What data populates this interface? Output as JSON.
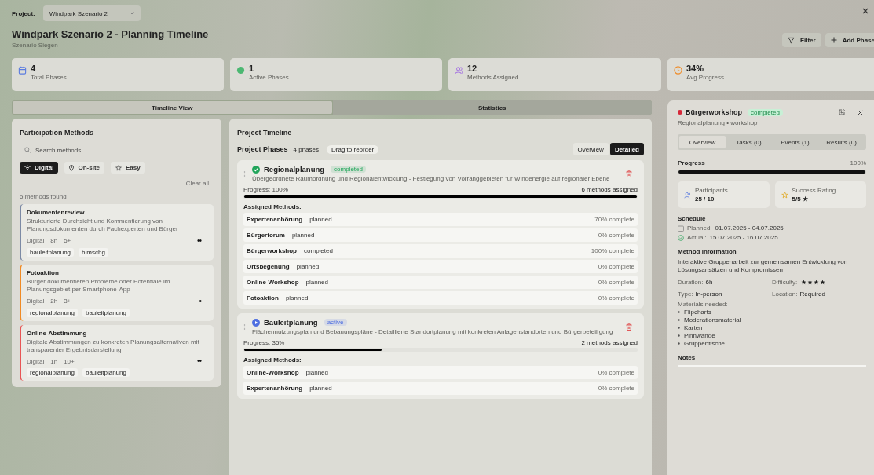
{
  "project": {
    "label": "Project:",
    "value": "Windpark Szenario 2"
  },
  "title": "Windpark Szenario 2 - Planning Timeline",
  "subtitle": "Szenario Siegen",
  "actions": [
    {
      "kind": "filter",
      "label": "Filter"
    },
    {
      "kind": "add",
      "label": "Add Phase"
    }
  ],
  "stats": [
    {
      "kind": "calendar",
      "value": "4",
      "label": "Total Phases"
    },
    {
      "kind": "dot",
      "value": "1",
      "label": "Active Phases"
    },
    {
      "kind": "people",
      "value": "12",
      "label": "Methods Assigned"
    },
    {
      "kind": "clock",
      "value": "34%",
      "label": "Avg Progress"
    }
  ],
  "view_tabs": [
    {
      "label": "Timeline View",
      "selected": true
    },
    {
      "label": "Statistics",
      "selected": false
    }
  ],
  "methods_panel": {
    "title": "Participation Methods",
    "search": {
      "placeholder": "Search methods..."
    },
    "chips": [
      {
        "kind": "wifi",
        "label": "Digital",
        "selected": true
      },
      {
        "kind": "pin",
        "label": "On-site",
        "selected": false
      },
      {
        "kind": "star",
        "label": "Easy",
        "selected": false
      }
    ],
    "clear": "Clear all",
    "count": "5 methods found",
    "methods": [
      {
        "name": "Dokumentenreview",
        "color": "#7c8aa5",
        "description": "Strukturierte Durchsicht und Kommentierung von Planungsdokumenten durch Fachexperten und Bürger",
        "mode": "Digital",
        "duration": "8h",
        "people": "5+",
        "dots": "••",
        "tags": [
          "bauleitplanung",
          "bimschg"
        ]
      },
      {
        "name": "Fotoaktion",
        "color": "#f08a24",
        "description": "Bürger dokumentieren Probleme oder Potentiale im Planungsgebiet per Smartphone-App",
        "mode": "Digital",
        "duration": "2h",
        "people": "3+",
        "dots": "•",
        "tags": [
          "regionalplanung",
          "bauleitplanung"
        ]
      },
      {
        "name": "Online-Abstimmung",
        "color": "#e85555",
        "description": "Digitale Abstimmungen zu konkreten Planungsalternativen mit transparenter Ergebnisdarstellung",
        "mode": "Digital",
        "duration": "1h",
        "people": "10+",
        "dots": "••",
        "tags": [
          "regionalplanung",
          "bauleitplanung"
        ]
      }
    ]
  },
  "timeline": {
    "title": "Project Timeline",
    "subtitle": "Project Phases",
    "phase_count": "4 phases",
    "drag_hint": "Drag to reorder",
    "modes": [
      {
        "label": "Overview",
        "selected": false
      },
      {
        "label": "Detailed",
        "selected": true
      }
    ],
    "phases": [
      {
        "name": "Regionalplanung",
        "kind": "check",
        "status": "completed",
        "color": "#22a55b",
        "description": "Übergeordnete Raumordnung und Regionalentwicklung - Festlegung von Vorranggebieten für Windenergie auf regionaler Ebene",
        "progress": "Progress: 100%",
        "level": 1,
        "assigned": "6 methods assigned",
        "methods_title": "Assigned Methods:",
        "methods": [
          {
            "name": "Expertenanhörung",
            "status": "planned",
            "complete": "70% complete"
          },
          {
            "name": "Bürgerforum",
            "status": "planned",
            "complete": "0% complete"
          },
          {
            "name": "Bürgerworkshop",
            "status": "completed",
            "complete": "100% complete"
          },
          {
            "name": "Ortsbegehung",
            "status": "planned",
            "complete": "0% complete"
          },
          {
            "name": "Online-Workshop",
            "status": "planned",
            "complete": "0% complete"
          },
          {
            "name": "Fotoaktion",
            "status": "planned",
            "complete": "0% complete"
          }
        ]
      },
      {
        "name": "Bauleitplanung",
        "kind": "play",
        "status": "active",
        "color": "#4f6fe0",
        "description": "Flächennutzungsplan und Bebauungspläne - Detaillierte Standortplanung mit konkreten Anlagenstandorten und Bürgerbeteiligung",
        "progress": "Progress: 35%",
        "level": 0.35,
        "assigned": "2 methods assigned",
        "methods_title": "Assigned Methods:",
        "methods": [
          {
            "name": "Online-Workshop",
            "status": "planned",
            "complete": "0% complete"
          },
          {
            "name": "Expertenanhörung",
            "status": "planned",
            "complete": "0% complete"
          }
        ]
      }
    ]
  },
  "detail": {
    "name": "Bürgerworkshop",
    "color": "#d62839",
    "status": "completed",
    "subtitle": "Regionalplanung • workshop",
    "tabs": [
      {
        "label": "Overview",
        "selected": true
      },
      {
        "label": "Tasks (0)",
        "selected": false
      },
      {
        "label": "Events (1)",
        "selected": false
      },
      {
        "label": "Results (0)",
        "selected": false
      }
    ],
    "progress_label": "Progress",
    "progress_value": "100%",
    "level": 1,
    "participants": {
      "label": "Participants",
      "value": "25 / 10"
    },
    "rating": {
      "label": "Success Rating",
      "value": "5/5 ★"
    },
    "schedule_title": "Schedule",
    "planned": {
      "label": "Planned:",
      "value": "01.07.2025 - 04.07.2025"
    },
    "actual": {
      "label": "Actual:",
      "value": "15.07.2025 - 16.07.2025"
    },
    "info_title": "Method Information",
    "info_text": "Interaktive Gruppenarbeit zur gemeinsamen Entwicklung von Lösungsansätzen und Kompromissen",
    "duration": {
      "label": "Duration:",
      "value": "6h"
    },
    "difficulty": {
      "label": "Difficulty:",
      "stars": 4
    },
    "type": {
      "label": "Type:",
      "value": "In-person"
    },
    "location": {
      "label": "Location:",
      "value": "Required"
    },
    "materials_title": "Materials needed:",
    "materials": [
      "Flipcharts",
      "Moderationsmaterial",
      "Karten",
      "Pinnwände",
      "Gruppentische"
    ],
    "notes_title": "Notes"
  }
}
